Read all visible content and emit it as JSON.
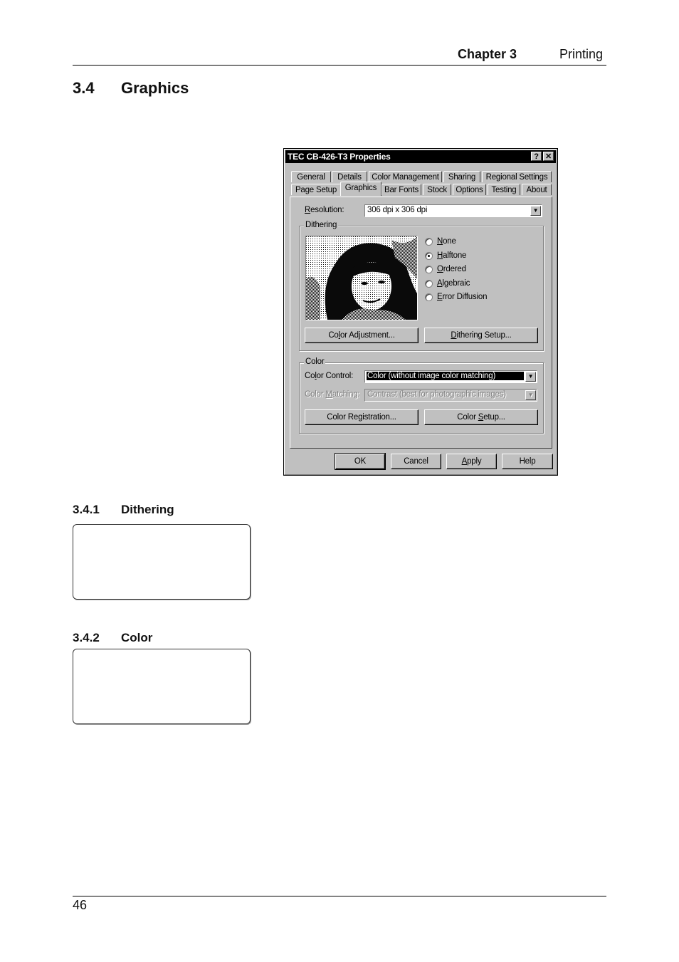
{
  "page_header": {
    "chapter": "Chapter 3",
    "title": "Printing"
  },
  "section": {
    "number": "3.4",
    "title": "Graphics"
  },
  "subsections": [
    {
      "number": "3.4.1",
      "title": "Dithering"
    },
    {
      "number": "3.4.2",
      "title": "Color"
    }
  ],
  "page_footer": {
    "page_number": "46"
  },
  "dialog": {
    "title": "TEC CB-426-T3 Properties",
    "help_button": "?",
    "close_button": "✕",
    "tabs_back_row": [
      "General",
      "Details",
      "Color Management",
      "Sharing",
      "Regional Settings"
    ],
    "tabs_front_row": [
      "Page Setup",
      "Graphics",
      "Bar Fonts",
      "Stock",
      "Options",
      "Testing",
      "About"
    ],
    "active_tab": "Graphics",
    "resolution": {
      "label_u": "R",
      "label_rest": "esolution:",
      "value": "306 dpi x 306 dpi"
    },
    "dithering": {
      "group_label": "Dithering",
      "preview_icon": "halftone-portrait-preview",
      "options": [
        {
          "u": "N",
          "rest": "one",
          "checked": false
        },
        {
          "u": "H",
          "rest": "alftone",
          "checked": true
        },
        {
          "u": "O",
          "rest": "rdered",
          "checked": false
        },
        {
          "u": "A",
          "rest": "lgebraic",
          "checked": false
        },
        {
          "u": "E",
          "rest": "rror Diffusion",
          "checked": false
        }
      ],
      "color_adjustment_pre": "Co",
      "color_adjustment_u": "l",
      "color_adjustment_post": "or Adjustment...",
      "dithering_setup_u": "D",
      "dithering_setup_post": "ithering Setup..."
    },
    "color": {
      "group_label": "Color",
      "control_label_pre": "Co",
      "control_label_u": "l",
      "control_label_post": "or Control:",
      "control_value": "Color (without image color matching)",
      "matching_label_pre": "Color ",
      "matching_label_u": "M",
      "matching_label_post": "atching:",
      "matching_value": "Contrast (best for photographic images)",
      "registration_pre": "Color Re",
      "registration_u": "g",
      "registration_post": "istration...",
      "setup_pre": "Color ",
      "setup_u": "S",
      "setup_post": "etup..."
    },
    "buttons": {
      "ok": "OK",
      "cancel": "Cancel",
      "apply_u": "A",
      "apply_rest": "pply",
      "help": "Help"
    }
  }
}
